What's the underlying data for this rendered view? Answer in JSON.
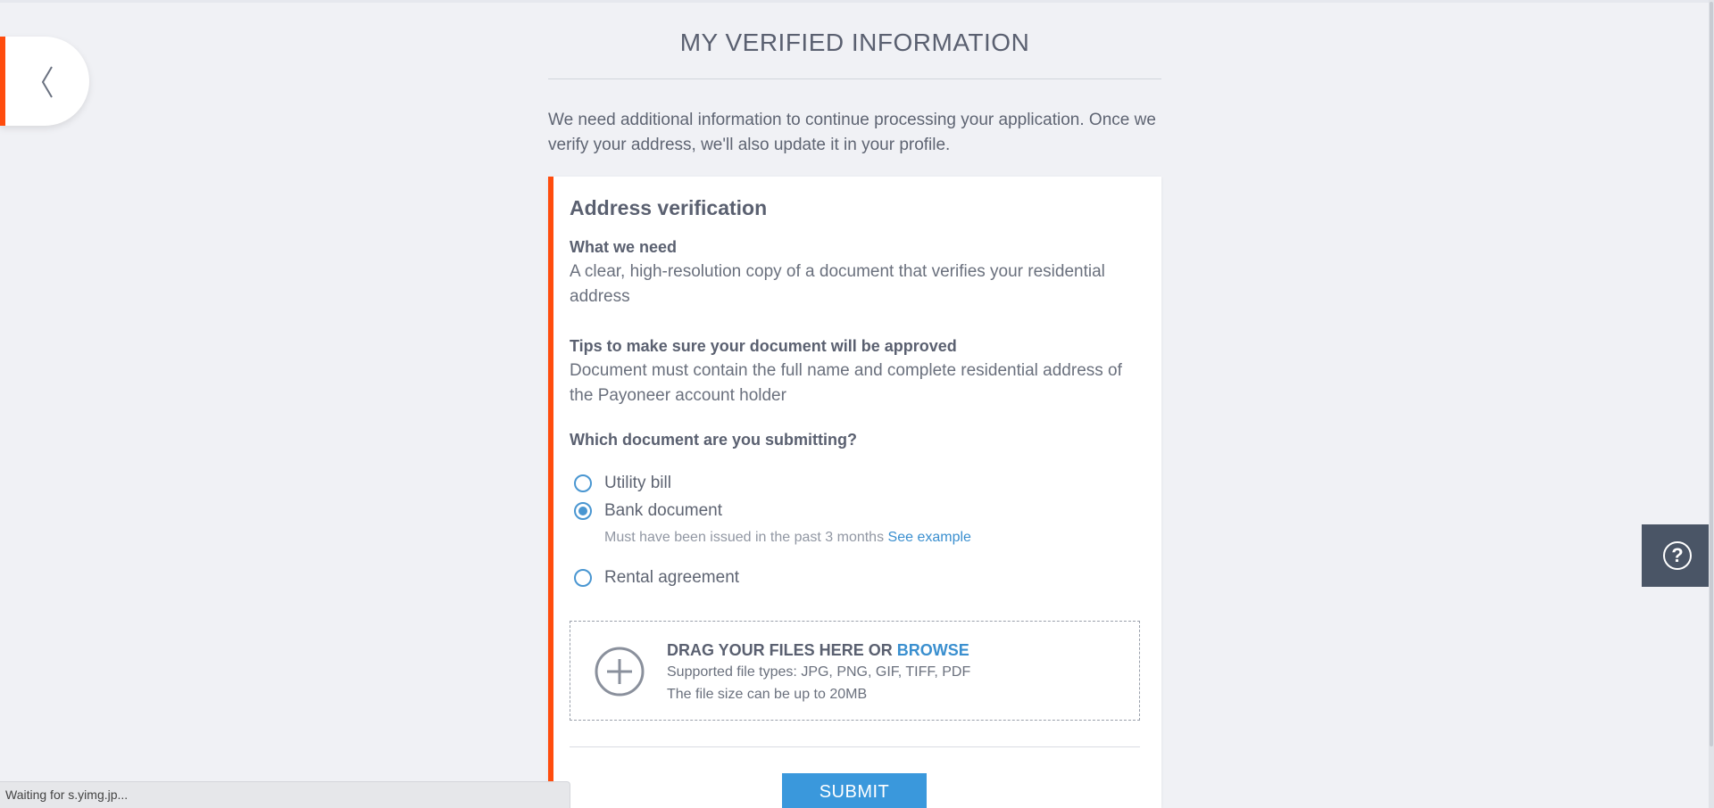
{
  "page": {
    "title": "MY VERIFIED INFORMATION",
    "intro": "We need additional information to continue processing your application. Once we verify your address, we'll also update it in your profile."
  },
  "card": {
    "heading": "Address verification",
    "what_label": "What we need",
    "what_text": "A clear, high-resolution copy of a document that verifies your residential address",
    "tips_label": "Tips to make sure your document will be approved",
    "tips_text": "Document must contain the full name and complete residential address of the Payoneer account holder",
    "question": "Which document are you submitting?",
    "options": [
      {
        "label": "Utility bill",
        "checked": false
      },
      {
        "label": "Bank document",
        "checked": true,
        "hint": "Must have been issued in the past 3 months",
        "hint_link": "See example"
      },
      {
        "label": "Rental agreement",
        "checked": false
      }
    ]
  },
  "dropzone": {
    "title": "DRAG YOUR FILES HERE OR",
    "browse": "BROWSE",
    "types": "Supported file types: JPG, PNG, GIF, TIFF, PDF",
    "size": "The file size can be up to 20MB"
  },
  "submit_label": "SUBMIT",
  "help_symbol": "?",
  "status_bar": "Waiting for s.yimg.jp...",
  "colors": {
    "accent": "#ff4c0d",
    "link": "#3a8fcf",
    "button": "#3a98dc",
    "help_bg": "#4a5566"
  }
}
